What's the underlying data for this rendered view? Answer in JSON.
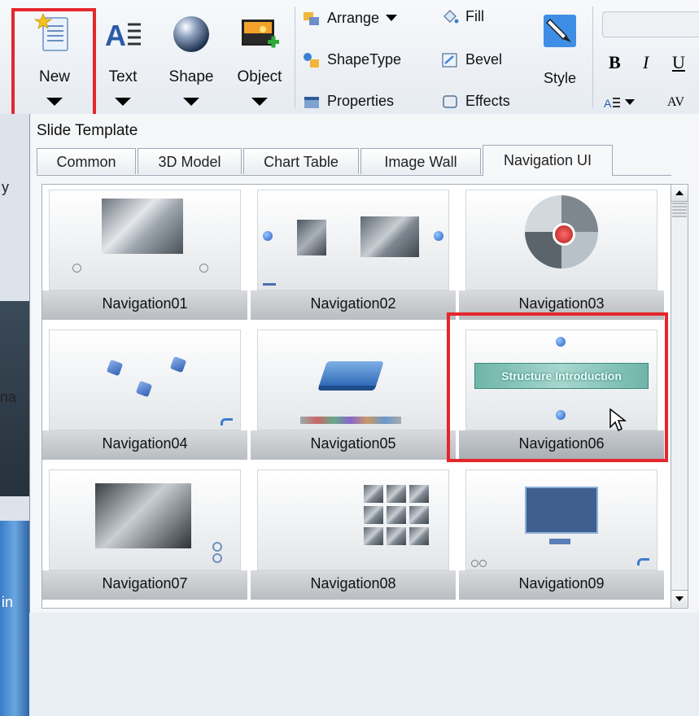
{
  "ribbon": {
    "new_label": "New",
    "text_label": "Text",
    "shape_label": "Shape",
    "object_label": "Object",
    "arrange_label": "Arrange",
    "shapetype_label": "ShapeType",
    "properties_label": "Properties",
    "fill_label": "Fill",
    "bevel_label": "Bevel",
    "effects_label": "Effects",
    "style_label": "Style",
    "bold_label": "B",
    "italic_label": "I",
    "underline_label": "U",
    "av_label": "AV",
    "highlight_color": "#e5262c"
  },
  "left_strip": {
    "text1": "y",
    "text2": "na",
    "text3": "in"
  },
  "panel": {
    "title": "Slide Template",
    "tabs": [
      {
        "label": "Common"
      },
      {
        "label": "3D Model"
      },
      {
        "label": "Chart Table"
      },
      {
        "label": "Image Wall"
      },
      {
        "label": "Navigation UI"
      }
    ],
    "active_tab": "Navigation UI",
    "templates": [
      {
        "caption": "Navigation01"
      },
      {
        "caption": "Navigation02"
      },
      {
        "caption": "Navigation03"
      },
      {
        "caption": "Navigation04"
      },
      {
        "caption": "Navigation05"
      },
      {
        "caption": "Navigation06",
        "thumb_text": "Structure Introduction"
      },
      {
        "caption": "Navigation07"
      },
      {
        "caption": "Navigation08"
      },
      {
        "caption": "Navigation09"
      }
    ],
    "selected_template": "Navigation06"
  }
}
